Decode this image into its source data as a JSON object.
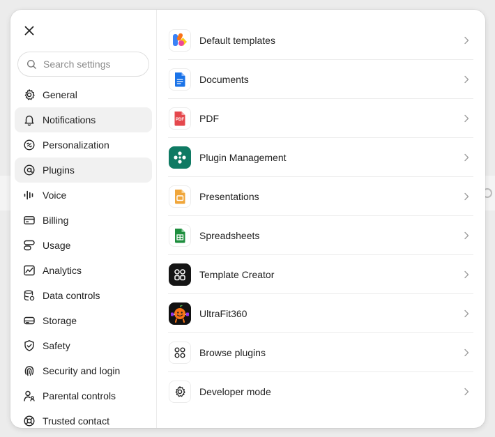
{
  "search": {
    "placeholder": "Search settings"
  },
  "sidebar": {
    "items": [
      {
        "label": "General",
        "icon": "gear-icon"
      },
      {
        "label": "Notifications",
        "icon": "bell-icon"
      },
      {
        "label": "Personalization",
        "icon": "personalization-icon"
      },
      {
        "label": "Plugins",
        "icon": "plugins-icon"
      },
      {
        "label": "Voice",
        "icon": "voice-waveform-icon"
      },
      {
        "label": "Billing",
        "icon": "credit-card-icon"
      },
      {
        "label": "Usage",
        "icon": "usage-icon"
      },
      {
        "label": "Analytics",
        "icon": "analytics-icon"
      },
      {
        "label": "Data controls",
        "icon": "database-icon"
      },
      {
        "label": "Storage",
        "icon": "storage-icon"
      },
      {
        "label": "Safety",
        "icon": "shield-icon"
      },
      {
        "label": "Security and login",
        "icon": "fingerprint-icon"
      },
      {
        "label": "Parental controls",
        "icon": "parental-icon"
      },
      {
        "label": "Trusted contact",
        "icon": "lifebuoy-icon"
      }
    ]
  },
  "plugins": [
    {
      "label": "Default templates",
      "icon": "default-templates-icon"
    },
    {
      "label": "Documents",
      "icon": "documents-icon"
    },
    {
      "label": "PDF",
      "icon": "pdf-icon",
      "icon_text": "PDF"
    },
    {
      "label": "Plugin Management",
      "icon": "plugin-management-icon"
    },
    {
      "label": "Presentations",
      "icon": "presentations-icon"
    },
    {
      "label": "Spreadsheets",
      "icon": "spreadsheets-icon"
    },
    {
      "label": "Template Creator",
      "icon": "template-creator-icon"
    },
    {
      "label": "UltraFit360",
      "icon": "ultrafit360-icon"
    },
    {
      "label": "Browse plugins",
      "icon": "browse-plugins-icon"
    },
    {
      "label": "Developer mode",
      "icon": "gear-icon"
    }
  ],
  "colors": {
    "highlight": "#f1f1f1",
    "pdf": "#e5484d",
    "documents": "#1a73e8",
    "plugin_management": "#0f7a63",
    "presentations": "#f0a63a",
    "spreadsheets": "#1e8e3e"
  }
}
